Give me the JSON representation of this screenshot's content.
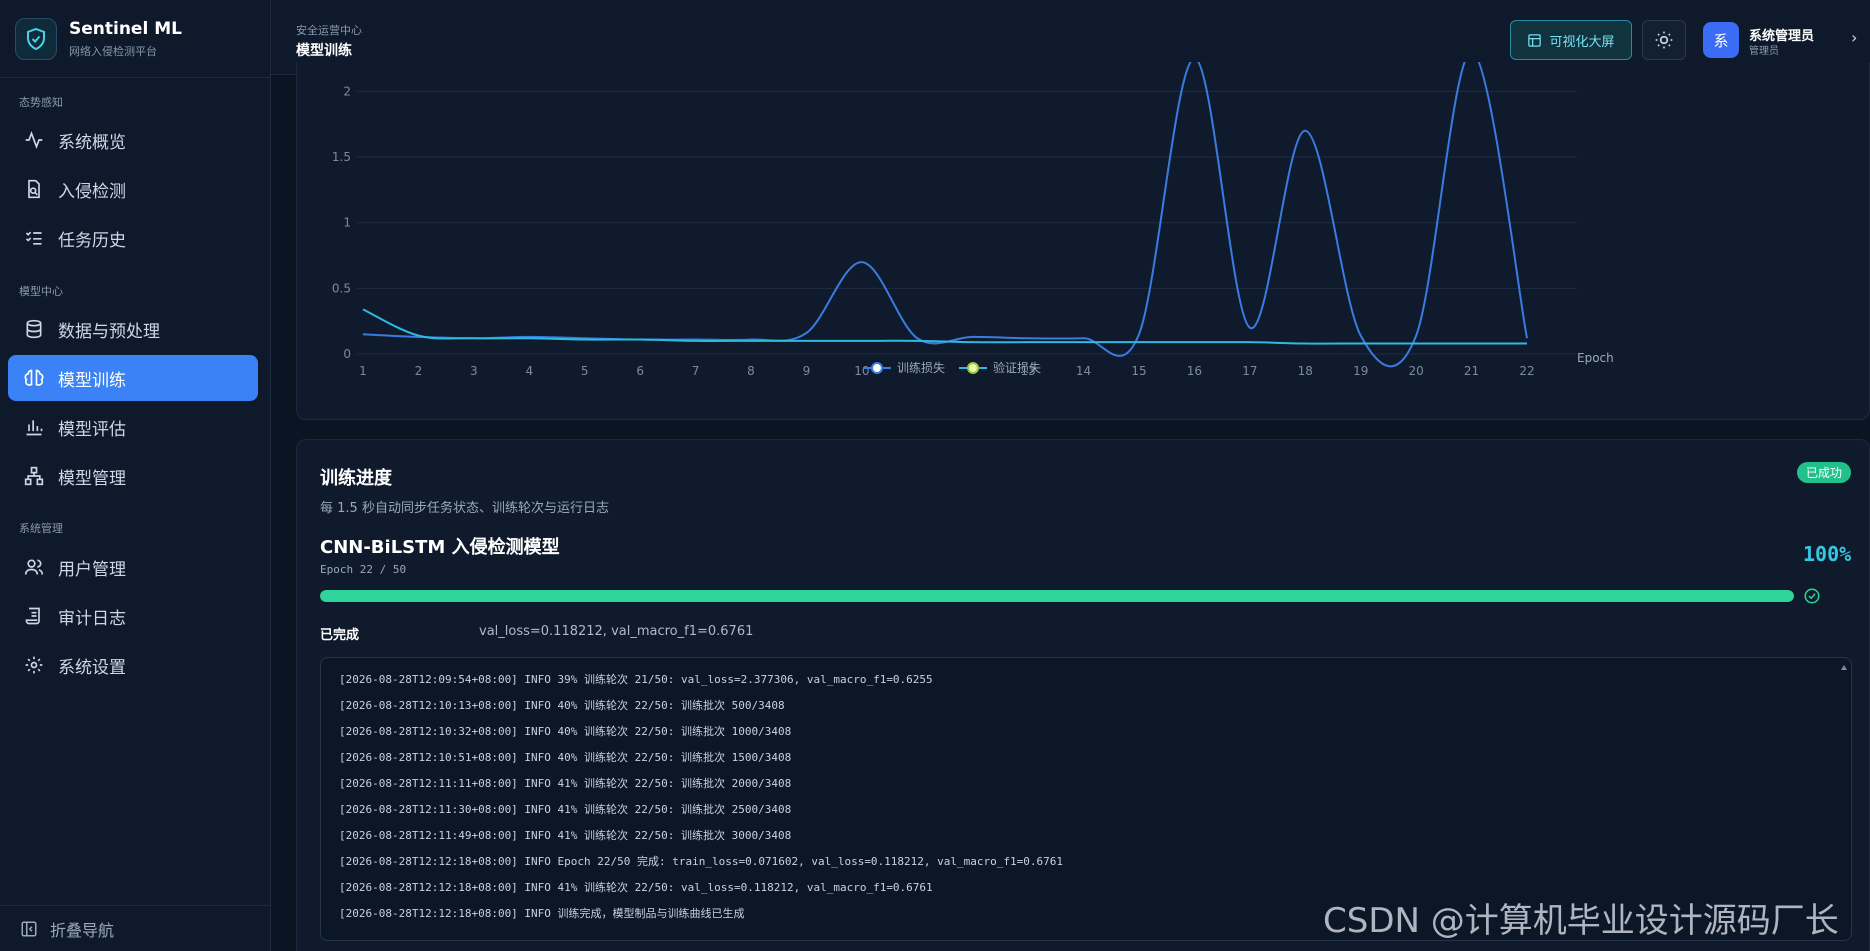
{
  "brand": {
    "title": "Sentinel ML",
    "subtitle": "网络入侵检测平台"
  },
  "nav": {
    "groups": [
      "态势感知",
      "模型中心",
      "系统管理"
    ],
    "items": [
      {
        "label": "系统概览",
        "icon": "pulse-icon"
      },
      {
        "label": "入侵检测",
        "icon": "file-search-icon"
      },
      {
        "label": "任务历史",
        "icon": "checklist-icon"
      },
      {
        "label": "数据与预处理",
        "icon": "database-icon"
      },
      {
        "label": "模型训练",
        "icon": "brain-icon",
        "active": true
      },
      {
        "label": "模型评估",
        "icon": "bar-chart-icon"
      },
      {
        "label": "模型管理",
        "icon": "hierarchy-icon"
      },
      {
        "label": "用户管理",
        "icon": "users-icon"
      },
      {
        "label": "审计日志",
        "icon": "scroll-icon"
      },
      {
        "label": "系统设置",
        "icon": "gear-icon"
      }
    ],
    "collapse_label": "折叠导航"
  },
  "header": {
    "breadcrumb_parent": "安全运营中心",
    "breadcrumb_current": "模型训练",
    "viz_button": "可视化大屏",
    "avatar_char": "系",
    "user_name": "系统管理员",
    "user_role": "管理员"
  },
  "chart_data": {
    "type": "line",
    "x": [
      1,
      2,
      3,
      4,
      5,
      6,
      7,
      8,
      9,
      10,
      11,
      12,
      13,
      14,
      15,
      16,
      17,
      18,
      19,
      20,
      21,
      22
    ],
    "x_tick_labels": [
      "1",
      "2",
      "3",
      "4",
      "5",
      "6",
      "7",
      "8",
      "9",
      "10",
      "",
      "",
      "13",
      "14",
      "15",
      "16",
      "17",
      "18",
      "19",
      "20",
      "21",
      "22"
    ],
    "y_ticks": [
      "0",
      "0.5",
      "1",
      "1.5",
      "2"
    ],
    "ylim": [
      0,
      2.3
    ],
    "xlabel": "Epoch",
    "legend_position": "bottom-center",
    "series": [
      {
        "name": "训练损失",
        "color": "#3a7be0",
        "values": [
          0.15,
          0.13,
          0.12,
          0.13,
          0.12,
          0.11,
          0.11,
          0.11,
          0.16,
          0.7,
          0.12,
          0.13,
          0.12,
          0.12,
          0.15,
          2.25,
          0.2,
          1.7,
          0.14,
          0.14,
          2.3,
          0.12
        ]
      },
      {
        "name": "验证损失",
        "color": "#2fb8e0",
        "values": [
          0.34,
          0.14,
          0.12,
          0.12,
          0.11,
          0.11,
          0.1,
          0.1,
          0.1,
          0.1,
          0.1,
          0.09,
          0.09,
          0.09,
          0.09,
          0.09,
          0.09,
          0.08,
          0.08,
          0.08,
          0.08,
          0.08
        ]
      }
    ]
  },
  "progress": {
    "title": "训练进度",
    "subtitle": "每 1.5 秒自动同步任务状态、训练轮次与运行日志",
    "badge": "已成功",
    "model_name": "CNN-BiLSTM 入侵检测模型",
    "epoch_text": "Epoch 22 / 50",
    "percent_text": "100%",
    "percent_value": 100,
    "status_label": "已完成",
    "status_detail": "val_loss=0.118212, val_macro_f1=0.6761"
  },
  "logs": [
    "[2026-08-28T12:09:54+08:00] INFO   39% 训练轮次 21/50: val_loss=2.377306, val_macro_f1=0.6255",
    "[2026-08-28T12:10:13+08:00] INFO   40% 训练轮次 22/50: 训练批次 500/3408",
    "[2026-08-28T12:10:32+08:00] INFO   40% 训练轮次 22/50: 训练批次 1000/3408",
    "[2026-08-28T12:10:51+08:00] INFO   40% 训练轮次 22/50: 训练批次 1500/3408",
    "[2026-08-28T12:11:11+08:00] INFO   41% 训练轮次 22/50: 训练批次 2000/3408",
    "[2026-08-28T12:11:30+08:00] INFO   41% 训练轮次 22/50: 训练批次 2500/3408",
    "[2026-08-28T12:11:49+08:00] INFO   41% 训练轮次 22/50: 训练批次 3000/3408",
    "[2026-08-28T12:12:18+08:00] INFO  Epoch 22/50 完成: train_loss=0.071602, val_loss=0.118212, val_macro_f1=0.6761",
    "[2026-08-28T12:12:18+08:00] INFO   41% 训练轮次 22/50: val_loss=0.118212, val_macro_f1=0.6761",
    "[2026-08-28T12:12:18+08:00] INFO  训练完成，模型制品与训练曲线已生成"
  ],
  "watermark": "CSDN @计算机毕业设计源码厂长",
  "colors": {
    "accent": "#3b82f6",
    "success": "#2ed49a",
    "cyan": "#38c6e0"
  }
}
